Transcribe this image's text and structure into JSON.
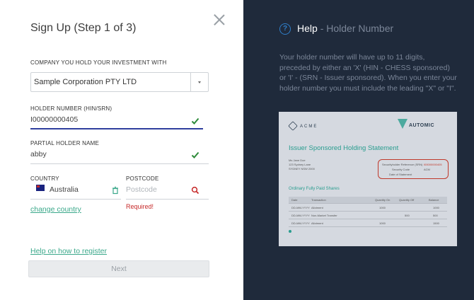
{
  "form": {
    "title": "Sign Up (Step 1 of 3)",
    "company_label": "COMPANY YOU HOLD YOUR INVESTMENT WITH",
    "company_value": "Sample Corporation PTY LTD",
    "holder_label": "HOLDER NUMBER (HIN/SRN)",
    "holder_value": "I00000000405",
    "partial_name_label": "PARTIAL HOLDER NAME",
    "partial_name_value": "abby",
    "country_label": "COUNTRY",
    "country_value": "Australia",
    "postcode_label": "POSTCODE",
    "postcode_placeholder": "Postcode",
    "postcode_error": "Required!",
    "change_country": "change country",
    "help_link": "Help on how to register",
    "next_button": "Next"
  },
  "help": {
    "title_main": "Help",
    "title_sub": "- Holder Number",
    "text": "Your holder number will have up to 11 digits, preceded by either an 'X' (HIN - CHESS sponsored) or 'I' - (SRN - Issuer sponsored). When you enter your holder number you must include the leading \"X\" or \"I\"."
  },
  "sample_doc": {
    "brand": "ACME",
    "heading": "Issuer Sponsored Holding Statement",
    "section": "Ordinary Fully Paid Shares",
    "registry": "AUTOMIC",
    "ref_label": "Securityholder Reference (SRN)",
    "ref_value": "I00000000405",
    "security_code_label": "Security Code",
    "security_code_value": "ACM",
    "date_label": "Date of Statement",
    "columns": [
      "Date",
      "Transaction",
      "Quantity On",
      "Quantity Off",
      "Balance"
    ],
    "rows": [
      [
        "DD-MM-YYYY",
        "Allotment",
        "1000",
        "",
        "1000"
      ],
      [
        "DD-MM-YYYY",
        "Non-Market Transfer",
        "",
        "500",
        "500"
      ],
      [
        "DD-MM-YYYY",
        "Allotment",
        "1000",
        "",
        "1500"
      ]
    ],
    "holder_name": "Ms Jane Doe",
    "holder_addr1": "123 Sydney Lane",
    "holder_addr2": "SYDNEY NSW 2000"
  },
  "colors": {
    "accent_green": "#3aa88a",
    "error_red": "#c62828",
    "panel_dark": "#1f2a3b",
    "help_blue": "#2f7fc9"
  }
}
